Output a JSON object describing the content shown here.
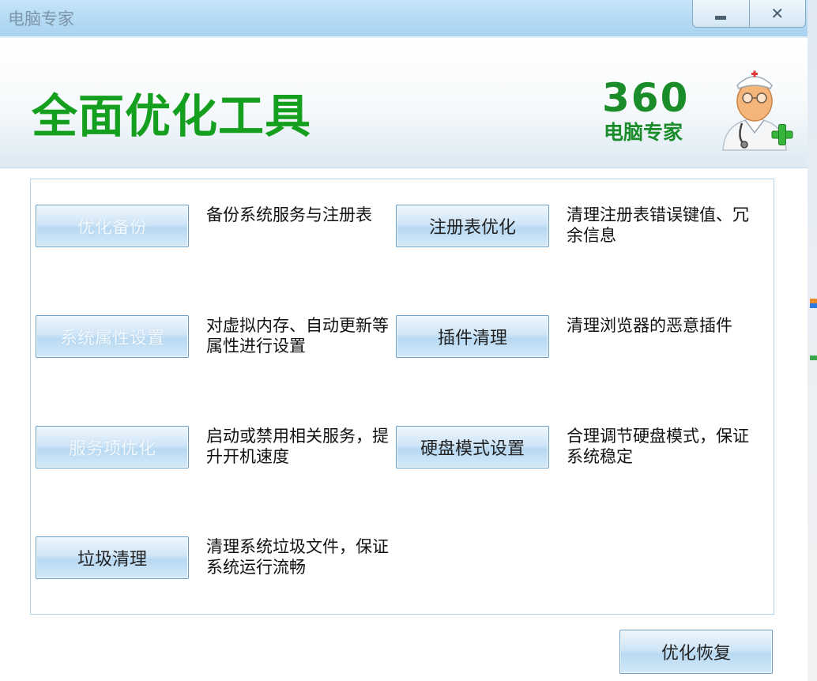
{
  "window": {
    "title": "电脑专家",
    "minimize_label": "_",
    "close_label": "✕"
  },
  "banner": {
    "title": "全面优化工具",
    "logo_number": "360",
    "logo_text": "电脑专家",
    "mascot_icon": "doctor-mascot-icon"
  },
  "tools": [
    {
      "label": "优化备份",
      "desc": "备份系统服务与注册表",
      "enabled": false
    },
    {
      "label": "注册表优化",
      "desc": "清理注册表错误键值、冗余信息",
      "enabled": true
    },
    {
      "label": "系统属性设置",
      "desc": "对虚拟内存、自动更新等属性进行设置",
      "enabled": false
    },
    {
      "label": "插件清理",
      "desc": "清理浏览器的恶意插件",
      "enabled": true
    },
    {
      "label": "服务项优化",
      "desc": "启动或禁用相关服务，提升开机速度",
      "enabled": false
    },
    {
      "label": "硬盘模式设置",
      "desc": "合理调节硬盘模式，保证系统稳定",
      "enabled": true
    },
    {
      "label": "垃圾清理",
      "desc": "清理系统垃圾文件，保证系统运行流畅",
      "enabled": true
    }
  ],
  "footer": {
    "restore_label": "优化恢复"
  },
  "colors": {
    "brand_green": "#14a01e",
    "titlebar": "#b5dbf4",
    "button_border": "#6b9fc7"
  }
}
